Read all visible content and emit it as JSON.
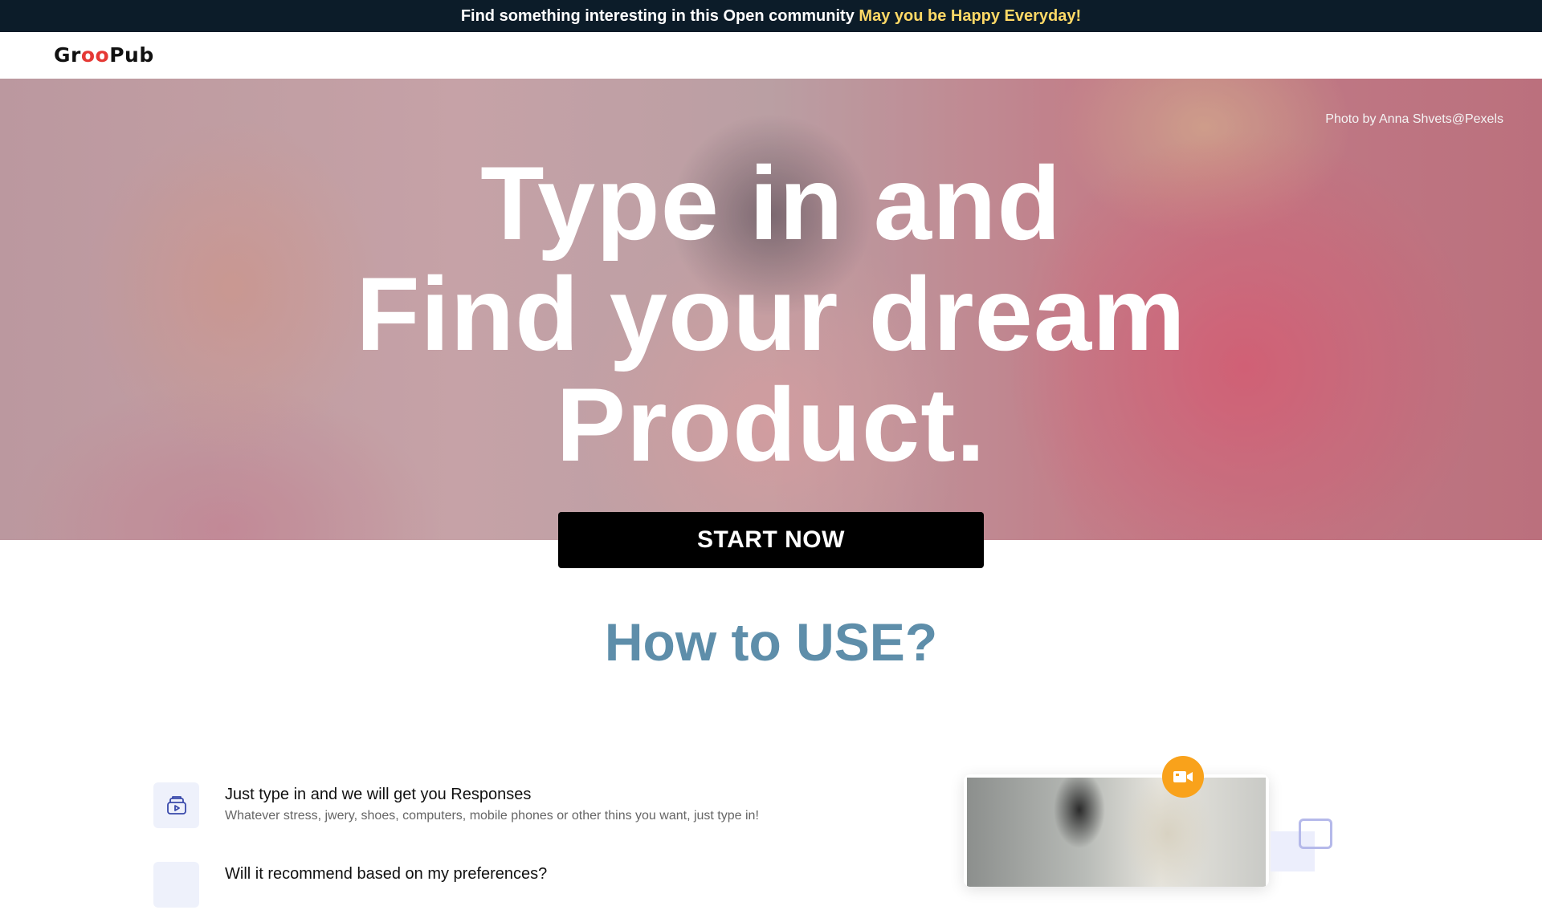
{
  "announcement": {
    "text": "Find something interesting in this Open community",
    "highlight": "May you be Happy Everyday!",
    "highlight_color": "#ffd966"
  },
  "nav": {
    "logo_part1": "Gr",
    "logo_part2": "oo",
    "logo_part3": "Pub",
    "logo_accent_color": "#e53935"
  },
  "hero": {
    "photo_credit": "Photo by Anna Shvets@Pexels",
    "headline_lines": [
      "Type in and",
      "Find your dream",
      "Product."
    ],
    "cta_label": "START NOW"
  },
  "how_to": {
    "title": "How to USE?",
    "title_color": "#5e8eaa",
    "features": [
      {
        "icon": "video-folder-icon",
        "title": "Just type in and we will get you Responses",
        "description": "Whatever stress, jwery, shoes, computers, mobile phones or other thins you want, just type in!"
      },
      {
        "icon": "feature-icon",
        "title": "Will it recommend based on my preferences?",
        "description": ""
      }
    ]
  },
  "preview": {
    "badge_icon": "video-camera-icon",
    "badge_color": "#f9a21b"
  }
}
